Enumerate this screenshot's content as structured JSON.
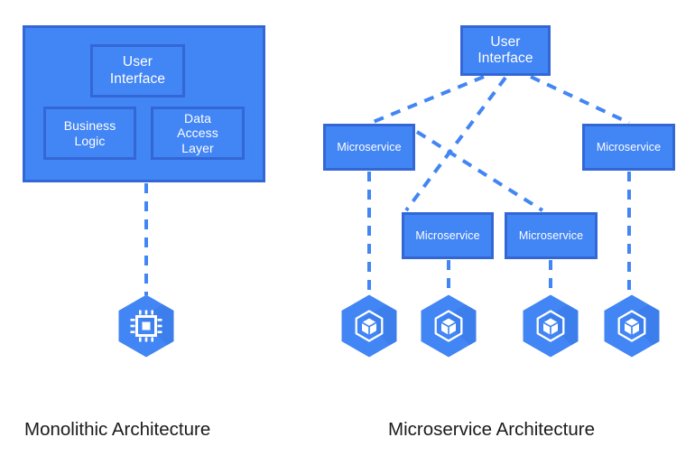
{
  "diagram": {
    "title_left": "Monolithic Architecture",
    "title_right": "Microservice Architecture",
    "colors": {
      "node_fill": "#4285f4",
      "node_border": "#3367d6",
      "connector": "#4285f4",
      "hex_fill": "#4285f4",
      "hex_shade": "#3c7ae4",
      "icon": "#ffffff",
      "caption_text": "#1b1b1b",
      "background": "#ffffff"
    },
    "connector_style": "dashed"
  },
  "monolith": {
    "container_label": "",
    "layers": [
      {
        "id": "ui",
        "label": "User\nInterface"
      },
      {
        "id": "business-logic",
        "label": "Business\nLogic"
      },
      {
        "id": "data-access-layer",
        "label": "Data\nAccess\nLayer"
      }
    ],
    "runtime": {
      "icon": "cpu-chip-icon",
      "shape": "hexagon",
      "count": 1
    },
    "connections": [
      {
        "from": "monolith-container",
        "to": "monolith-runtime-hexagon",
        "style": "dashed"
      }
    ]
  },
  "microservices": {
    "ui": {
      "id": "ms-ui",
      "label": "User\nInterface"
    },
    "services": [
      {
        "id": "microservice-1",
        "label": "Microservice"
      },
      {
        "id": "microservice-2",
        "label": "Microservice"
      },
      {
        "id": "microservice-3",
        "label": "Microservice"
      },
      {
        "id": "microservice-4",
        "label": "Microservice"
      }
    ],
    "runtimes": [
      {
        "id": "runtime-1",
        "icon": "container-cube-icon",
        "shape": "hexagon"
      },
      {
        "id": "runtime-2",
        "icon": "container-cube-icon",
        "shape": "hexagon"
      },
      {
        "id": "runtime-3",
        "icon": "container-cube-icon",
        "shape": "hexagon"
      },
      {
        "id": "runtime-4",
        "icon": "container-cube-icon",
        "shape": "hexagon"
      }
    ],
    "connections": [
      {
        "from": "ms-ui",
        "to": "microservice-1",
        "style": "dashed"
      },
      {
        "from": "ms-ui",
        "to": "microservice-2",
        "style": "dashed"
      },
      {
        "from": "ms-ui",
        "to": "microservice-4",
        "style": "dashed"
      },
      {
        "from": "microservice-1",
        "to": "microservice-3",
        "style": "dashed"
      },
      {
        "from": "microservice-1",
        "to": "runtime-1",
        "style": "dashed"
      },
      {
        "from": "microservice-2",
        "to": "runtime-2",
        "style": "dashed"
      },
      {
        "from": "microservice-3",
        "to": "runtime-3",
        "style": "dashed"
      },
      {
        "from": "microservice-4",
        "to": "runtime-4",
        "style": "dashed"
      }
    ]
  }
}
